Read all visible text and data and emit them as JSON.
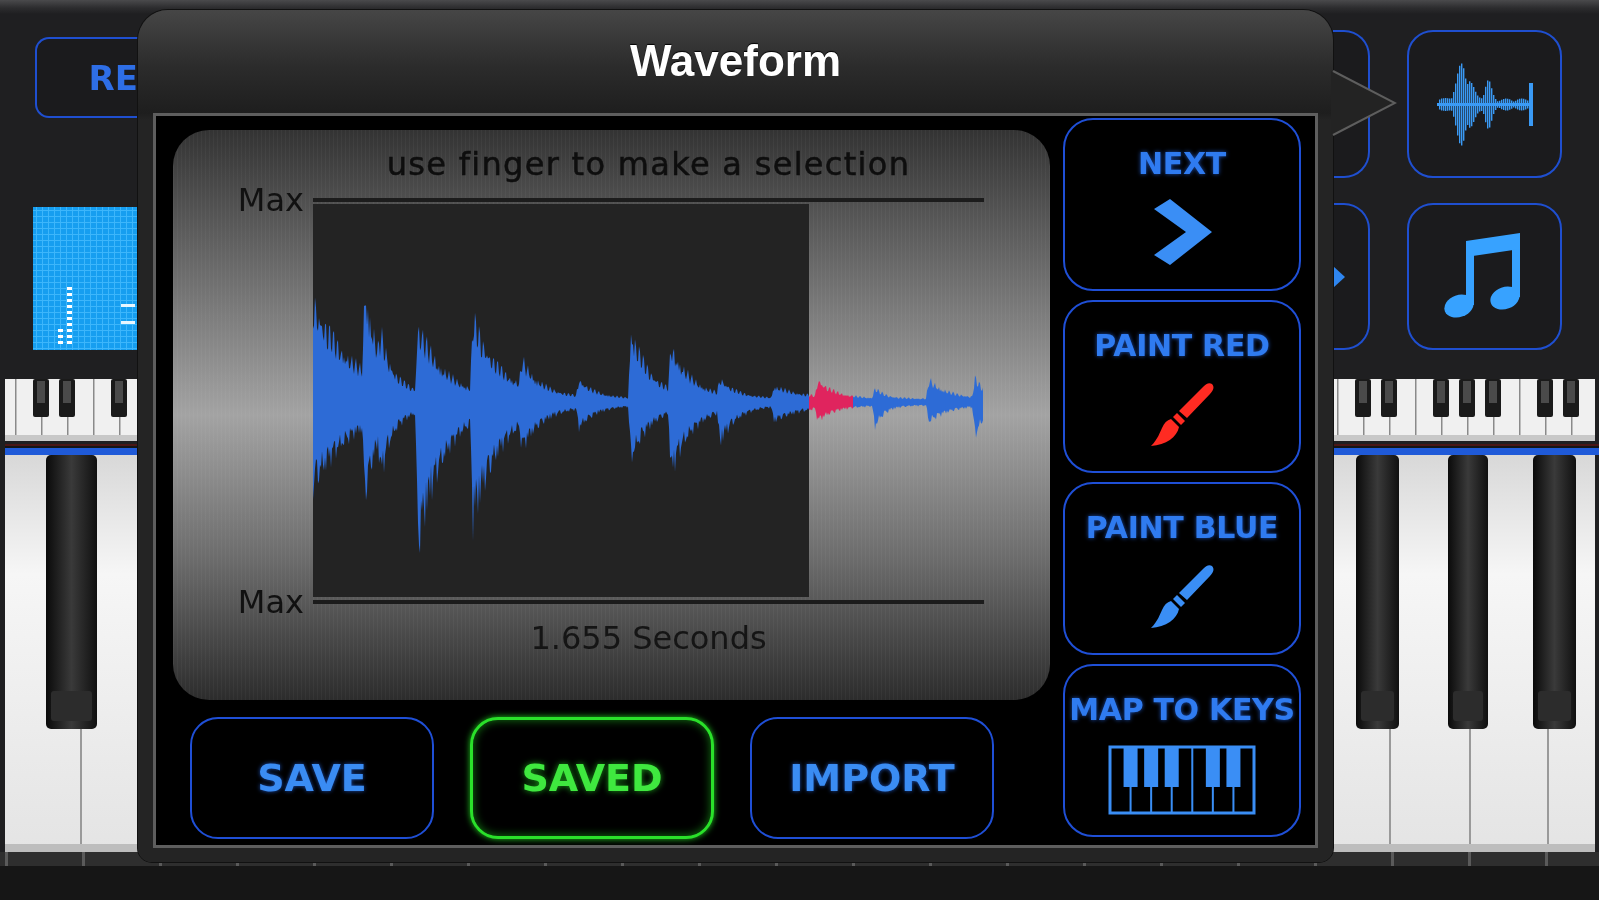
{
  "app": {
    "background_button": {
      "label": "RE"
    }
  },
  "popover": {
    "title": "Waveform",
    "editor": {
      "hint": "use finger to make a selection",
      "top_label": "Max",
      "bottom_label": "Max",
      "duration": "1.655 Seconds"
    },
    "actions": [
      {
        "label": "SAVE",
        "highlighted": false
      },
      {
        "label": "SAVED",
        "highlighted": true
      },
      {
        "label": "IMPORT",
        "highlighted": false
      }
    ],
    "tools": [
      {
        "label": "NEXT",
        "kind": "arrow"
      },
      {
        "label": "PAINT RED",
        "kind": "brush",
        "color": "#ff2b22"
      },
      {
        "label": "PAINT BLUE",
        "kind": "brush",
        "color": "#3a8ef5"
      },
      {
        "label": "MAP TO KEYS",
        "kind": "keys"
      }
    ]
  }
}
